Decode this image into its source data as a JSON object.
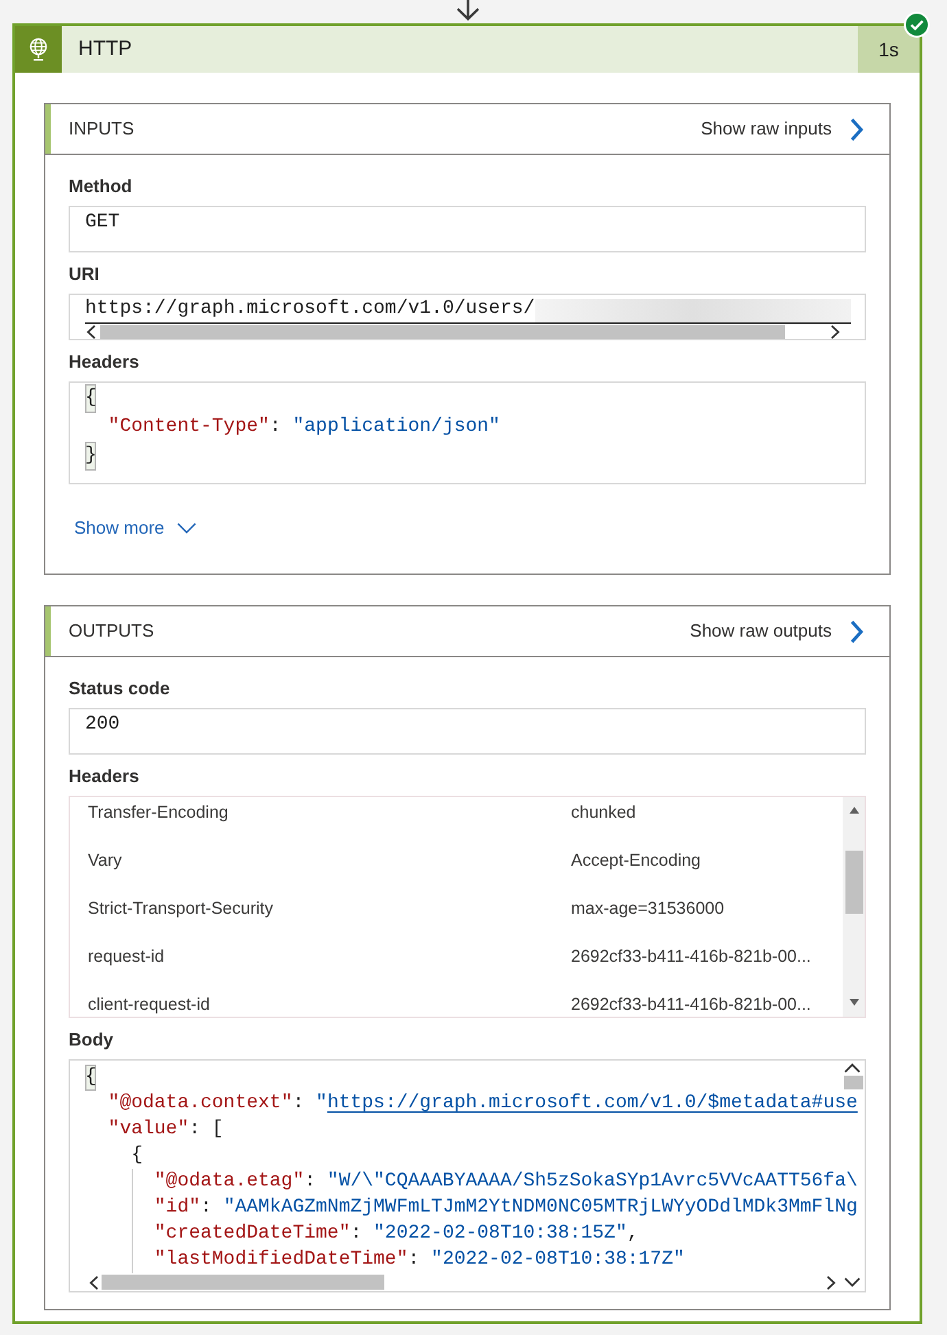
{
  "action": {
    "title": "HTTP",
    "duration": "1s",
    "succeeded": true
  },
  "sections": [
    {
      "title": "INPUTS",
      "raw_link": "Show raw inputs",
      "fields": [
        {
          "kind": "text",
          "label": "Method",
          "value": "GET"
        },
        {
          "kind": "url",
          "label": "URI",
          "value": "https://graph.microsoft.com/v1.0/users/"
        },
        {
          "kind": "code",
          "label": "Headers",
          "lines": [
            {
              "tokens": [
                {
                  "kind": "bracket",
                  "text": "{"
                }
              ],
              "children": [
                {
                  "tokens": [
                    {
                      "kind": "key",
                      "text": "\"Content-Type\""
                    },
                    {
                      "kind": "punct",
                      "text": ": "
                    },
                    {
                      "kind": "string",
                      "text": "\"application/json\""
                    }
                  ]
                }
              ]
            },
            {
              "tokens": [
                {
                  "kind": "bracket",
                  "text": "}"
                }
              ]
            }
          ]
        }
      ],
      "show_more": "Show more"
    },
    {
      "title": "OUTPUTS",
      "raw_link": "Show raw outputs",
      "fields": [
        {
          "kind": "text",
          "label": "Status code",
          "value": "200"
        },
        {
          "kind": "table",
          "label": "Headers",
          "rows": [
            {
              "name": "Transfer-Encoding",
              "value": "chunked"
            },
            {
              "name": "Vary",
              "value": "Accept-Encoding"
            },
            {
              "name": "Strict-Transport-Security",
              "value": "max-age=31536000"
            },
            {
              "name": "request-id",
              "value": "2692cf33-b411-416b-821b-00..."
            },
            {
              "name": "client-request-id",
              "value": "2692cf33-b411-416b-821b-00..."
            }
          ]
        },
        {
          "kind": "editor",
          "label": "Body",
          "lines": [
            {
              "tokens": [
                {
                  "kind": "bracket",
                  "text": "{"
                }
              ],
              "children": [
                {
                  "tokens": [
                    {
                      "kind": "key",
                      "text": "\"@odata.context\""
                    },
                    {
                      "kind": "punct",
                      "text": ": "
                    },
                    {
                      "kind": "string",
                      "text": "\""
                    },
                    {
                      "kind": "link",
                      "text": "https://graph.microsoft.com/v1.0/$metadata#use"
                    }
                  ]
                },
                {
                  "tokens": [
                    {
                      "kind": "key",
                      "text": "\"value\""
                    },
                    {
                      "kind": "punct",
                      "text": ": ["
                    }
                  ],
                  "children": [
                    {
                      "tokens": [
                        {
                          "kind": "punct",
                          "text": "{"
                        }
                      ],
                      "children": [
                        {
                          "tokens": [
                            {
                              "kind": "key",
                              "text": "\"@odata.etag\""
                            },
                            {
                              "kind": "punct",
                              "text": ": "
                            },
                            {
                              "kind": "string",
                              "text": "\"W/\\\"CQAAABYAAAA/Sh5zSokaSYp1Avrc5VVcAATT56fa\\"
                            }
                          ]
                        },
                        {
                          "tokens": [
                            {
                              "kind": "key",
                              "text": "\"id\""
                            },
                            {
                              "kind": "punct",
                              "text": ": "
                            },
                            {
                              "kind": "string",
                              "text": "\"AAMkAGZmNmZjMWFmLTJmM2YtNDM0NC05MTRjLWYyODdlMDk3MmFlNg"
                            }
                          ]
                        },
                        {
                          "tokens": [
                            {
                              "kind": "key",
                              "text": "\"createdDateTime\""
                            },
                            {
                              "kind": "punct",
                              "text": ": "
                            },
                            {
                              "kind": "string",
                              "text": "\"2022-02-08T10:38:15Z\""
                            },
                            {
                              "kind": "punct",
                              "text": ","
                            }
                          ]
                        },
                        {
                          "tokens": [
                            {
                              "kind": "key",
                              "text": "\"lastModifiedDateTime\""
                            },
                            {
                              "kind": "punct",
                              "text": ": "
                            },
                            {
                              "kind": "string",
                              "text": "\"2022-02-08T10:38:17Z\""
                            }
                          ]
                        }
                      ]
                    }
                  ]
                }
              ]
            }
          ]
        }
      ]
    }
  ]
}
